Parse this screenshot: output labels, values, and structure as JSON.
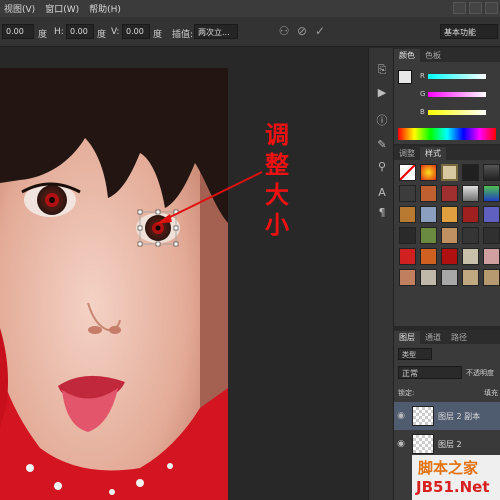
{
  "menu": {
    "items": [
      "视图(V)",
      "窗口(W)",
      "帮助(H)"
    ]
  },
  "options": {
    "x_value": "0.00",
    "unit": "度",
    "h_label": "H:",
    "h_value": "0.00",
    "v_label": "V:",
    "v_value": "0.00",
    "interp_label": "插值:",
    "interp_value": "两次立...",
    "workspace_value": "基本功能"
  },
  "annotation": {
    "lines": [
      "调",
      "整",
      "大",
      "小"
    ],
    "color": "#ee1111"
  },
  "color_panel": {
    "tabs": [
      "颜色",
      "色板"
    ],
    "channels": [
      "R",
      "G",
      "B"
    ]
  },
  "styles_panel": {
    "tabs": [
      "调整",
      "样式"
    ]
  },
  "layers_panel": {
    "tabs": [
      "图层",
      "通道",
      "路径"
    ],
    "kind_label": "类型",
    "blend_mode": "正常",
    "opacity_label": "不透明度",
    "lock_label": "锁定:",
    "fill_label": "填充",
    "layers": [
      "图层 2 副本",
      "图层 2"
    ]
  },
  "watermark": {
    "top": "脚本之家",
    "bottom": "JB51.Net"
  }
}
